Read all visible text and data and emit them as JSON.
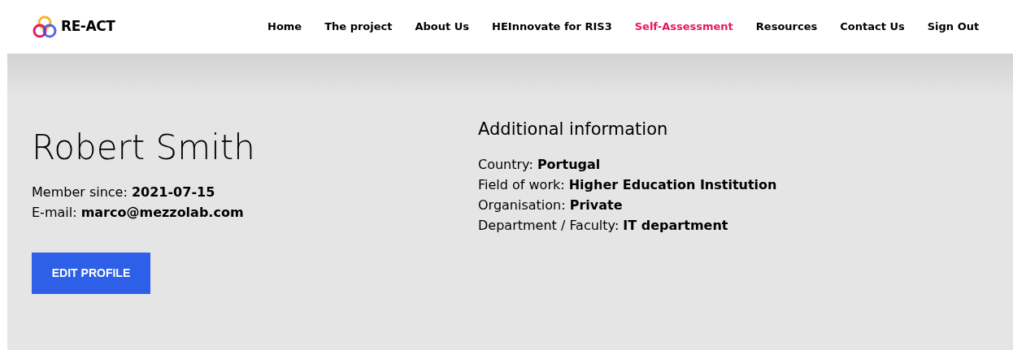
{
  "header": {
    "logo": "RE-ACT",
    "nav": [
      {
        "label": "Home",
        "selected": false
      },
      {
        "label": "The project",
        "selected": false
      },
      {
        "label": "About Us",
        "selected": false
      },
      {
        "label": "HEInnovate for RIS3",
        "selected": false
      },
      {
        "label": "Self-Assessment",
        "selected": true
      },
      {
        "label": "Resources",
        "selected": false
      },
      {
        "label": "Contact Us",
        "selected": false
      },
      {
        "label": "Sign Out",
        "selected": false
      }
    ]
  },
  "profile": {
    "name": "Robert Smith",
    "details": [
      "Member since: **2021-07-15**",
      "E-mail: **marco@mezzolab.com**"
    ],
    "button": "EDIT PROFILE"
  },
  "additional": {
    "title": "Additional information",
    "details": [
      "Country: **Portugal**",
      "Field of work: **Higher Education Institution**",
      "Organisation: **Private**",
      "Department / Faculty: **IT department**"
    ]
  }
}
